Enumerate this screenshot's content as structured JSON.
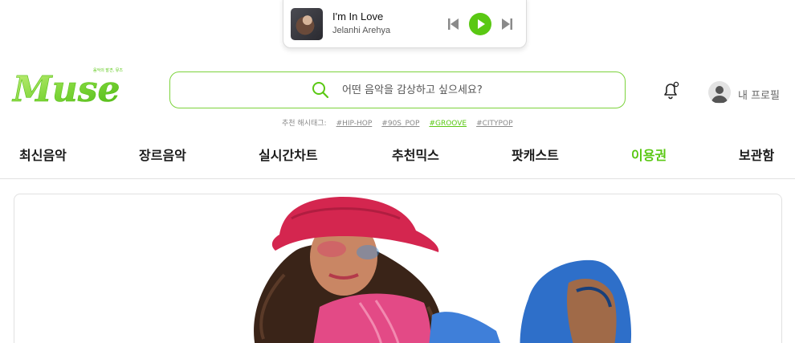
{
  "player": {
    "track_title": "I'm In Love",
    "artist": "Jelanhi Arehya",
    "icons": {
      "prev": "skip-previous-icon",
      "play": "play-icon",
      "next": "skip-next-icon"
    },
    "play_color": "#5ac813"
  },
  "header": {
    "logo_text": "Muse",
    "logo_tagline": "음악의 발견, 뮤즈",
    "search": {
      "placeholder": "어떤 음악을 감상하고 싶으세요?",
      "icon": "search-icon"
    },
    "hashtags": {
      "label": "추천 해시태그:",
      "tags": [
        "#HIP-HOP",
        "#90S_POP",
        "#GROOVE",
        "#CITYPOP"
      ],
      "active_index": 2
    },
    "bell_icon": "bell-icon",
    "profile_label": "내 프로필"
  },
  "nav": {
    "items": [
      "최신음악",
      "장르음악",
      "실시간차트",
      "추천믹스",
      "팟캐스트",
      "이용권",
      "보관함"
    ],
    "active_index": 5
  },
  "colors": {
    "accent": "#5ac813",
    "text": "#1a1a1a",
    "muted": "#8a8a8a",
    "border": "#e2e2e2"
  }
}
